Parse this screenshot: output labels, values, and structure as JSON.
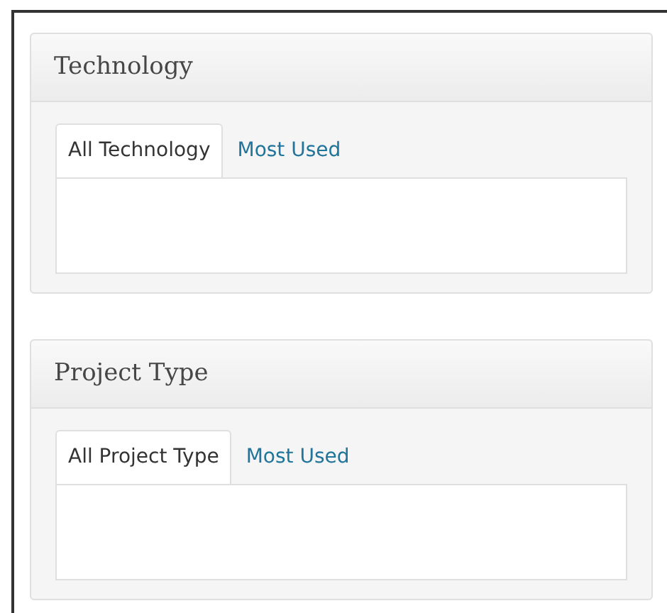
{
  "boxes": [
    {
      "title": "Technology",
      "tabs": [
        {
          "label": "All Technology",
          "selected": true
        },
        {
          "label": "Most Used",
          "selected": false
        }
      ]
    },
    {
      "title": "Project Type",
      "tabs": [
        {
          "label": "All Project Type",
          "selected": true
        },
        {
          "label": "Most Used",
          "selected": false
        }
      ]
    }
  ]
}
